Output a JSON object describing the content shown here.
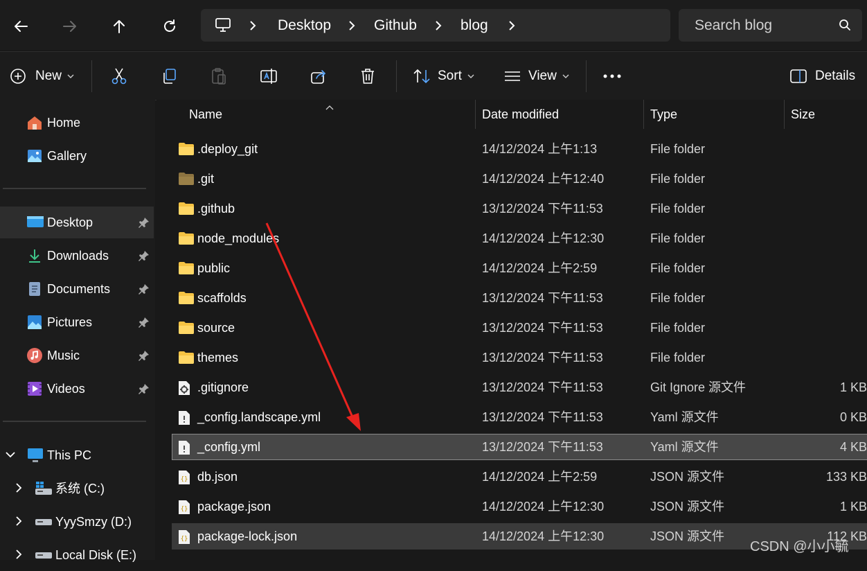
{
  "nav": {
    "back": "back-arrow-icon",
    "forward": "forward-arrow-icon",
    "up": "up-arrow-icon",
    "refresh": "refresh-icon"
  },
  "breadcrumb": [
    "Desktop",
    "Github",
    "blog"
  ],
  "search": {
    "placeholder": "Search blog"
  },
  "toolbar": {
    "new_label": "New",
    "sort_label": "Sort",
    "view_label": "View",
    "details_label": "Details"
  },
  "sidebar": {
    "top": [
      {
        "label": "Home",
        "icon": "home-icon"
      },
      {
        "label": "Gallery",
        "icon": "gallery-icon"
      }
    ],
    "quick": [
      {
        "label": "Desktop",
        "icon": "desktop-icon",
        "selected": true
      },
      {
        "label": "Downloads",
        "icon": "downloads-icon"
      },
      {
        "label": "Documents",
        "icon": "documents-icon"
      },
      {
        "label": "Pictures",
        "icon": "pictures-icon"
      },
      {
        "label": "Music",
        "icon": "music-icon"
      },
      {
        "label": "Videos",
        "icon": "videos-icon"
      }
    ],
    "this_pc": "This PC",
    "drives": [
      {
        "label": "系统 (C:)"
      },
      {
        "label": "YyySmzy (D:)"
      },
      {
        "label": "Local Disk (E:)"
      }
    ]
  },
  "columns": {
    "name": "Name",
    "date": "Date modified",
    "type": "Type",
    "size": "Size"
  },
  "files": [
    {
      "name": ".deploy_git",
      "date": "14/12/2024 上午1:13",
      "type": "File folder",
      "size": "",
      "kind": "folder"
    },
    {
      "name": ".git",
      "date": "14/12/2024 上午12:40",
      "type": "File folder",
      "size": "",
      "kind": "folder-dim"
    },
    {
      "name": ".github",
      "date": "13/12/2024 下午11:53",
      "type": "File folder",
      "size": "",
      "kind": "folder"
    },
    {
      "name": "node_modules",
      "date": "14/12/2024 上午12:30",
      "type": "File folder",
      "size": "",
      "kind": "folder"
    },
    {
      "name": "public",
      "date": "14/12/2024 上午2:59",
      "type": "File folder",
      "size": "",
      "kind": "folder"
    },
    {
      "name": "scaffolds",
      "date": "13/12/2024 下午11:53",
      "type": "File folder",
      "size": "",
      "kind": "folder"
    },
    {
      "name": "source",
      "date": "13/12/2024 下午11:53",
      "type": "File folder",
      "size": "",
      "kind": "folder"
    },
    {
      "name": "themes",
      "date": "13/12/2024 下午11:53",
      "type": "File folder",
      "size": "",
      "kind": "folder"
    },
    {
      "name": ".gitignore",
      "date": "13/12/2024 下午11:53",
      "type": "Git Ignore 源文件",
      "size": "1 KB",
      "kind": "gear"
    },
    {
      "name": "_config.landscape.yml",
      "date": "13/12/2024 下午11:53",
      "type": "Yaml 源文件",
      "size": "0 KB",
      "kind": "yaml"
    },
    {
      "name": "_config.yml",
      "date": "13/12/2024 下午11:53",
      "type": "Yaml 源文件",
      "size": "4 KB",
      "kind": "yaml",
      "selected": true
    },
    {
      "name": "db.json",
      "date": "14/12/2024 上午2:59",
      "type": "JSON 源文件",
      "size": "133 KB",
      "kind": "json"
    },
    {
      "name": "package.json",
      "date": "14/12/2024 上午12:30",
      "type": "JSON 源文件",
      "size": "1 KB",
      "kind": "json"
    },
    {
      "name": "package-lock.json",
      "date": "14/12/2024 上午12:30",
      "type": "JSON 源文件",
      "size": "112 KB",
      "kind": "json",
      "hover": true
    }
  ],
  "watermark": "CSDN @小小毓",
  "colors": {
    "folder": "#f6c343",
    "accent_arrow": "#e8231f",
    "selected_row": "#474747"
  }
}
